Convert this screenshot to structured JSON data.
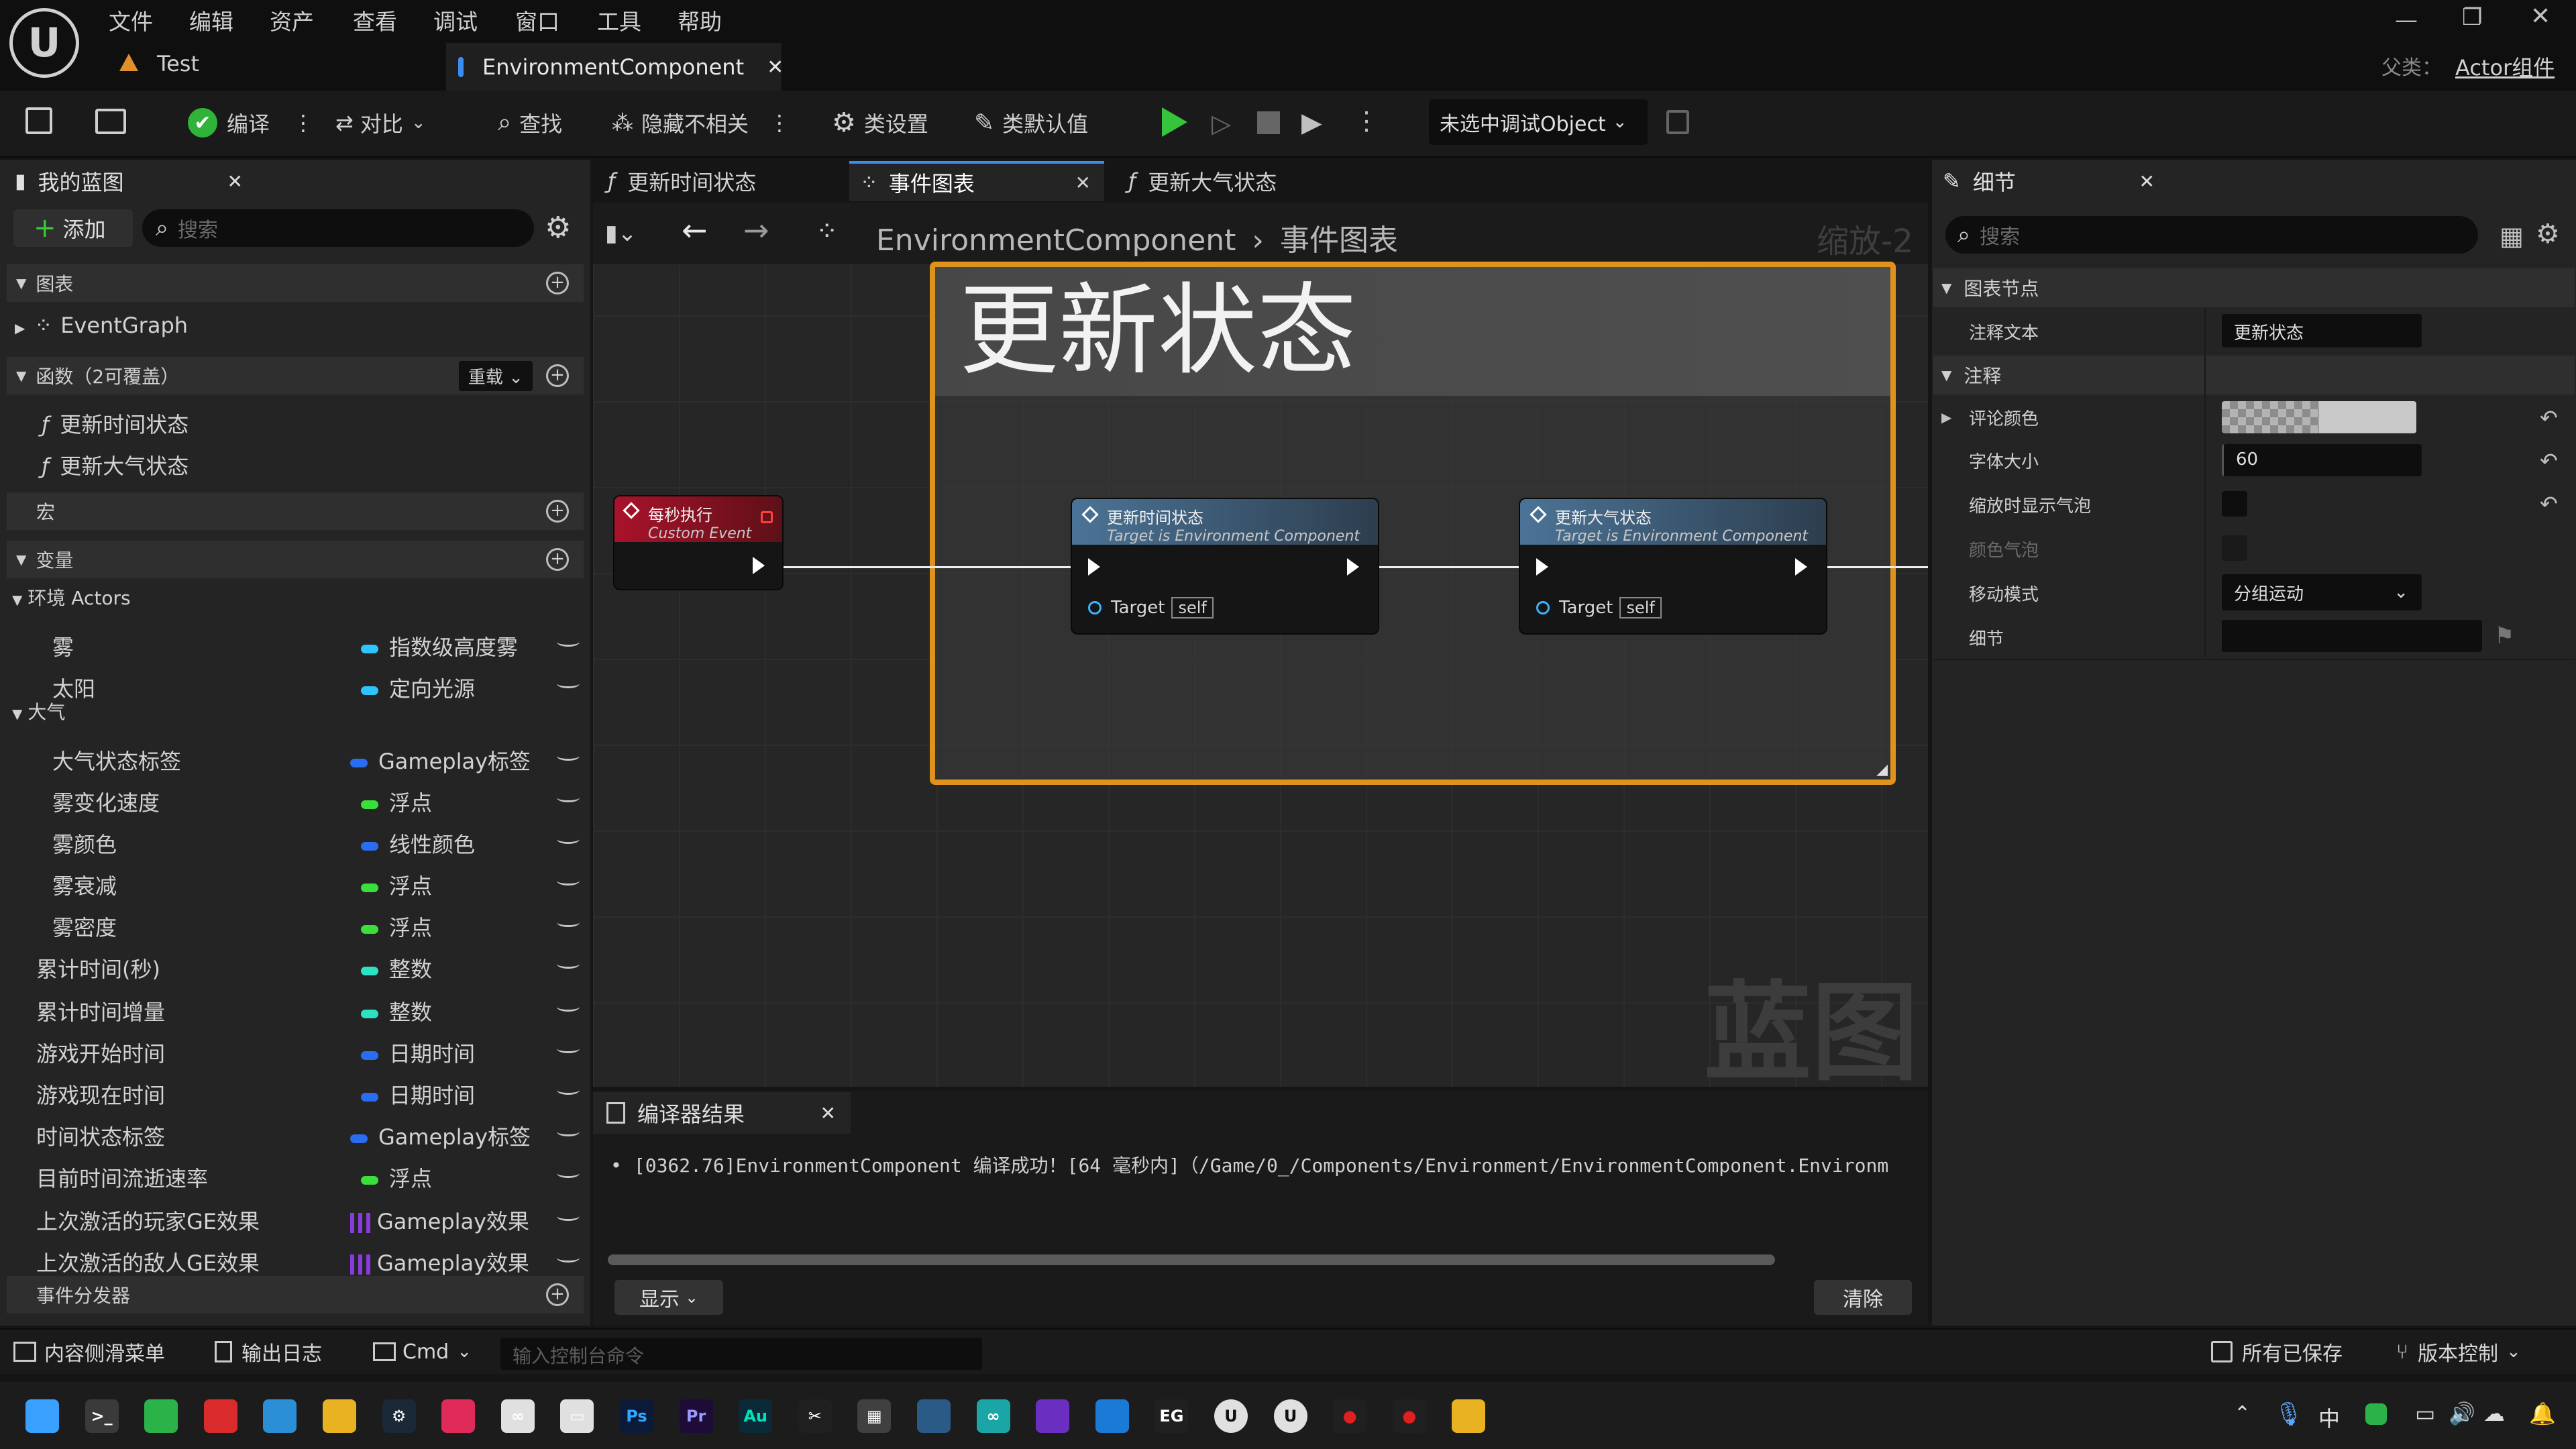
{
  "app": {
    "logo_text": "U",
    "project": "Test",
    "active_tab": "EnvironmentComponent",
    "parent_class_label": "父类：",
    "parent_class_value": "Actor组件"
  },
  "menu": [
    "文件",
    "编辑",
    "资产",
    "查看",
    "调试",
    "窗口",
    "工具",
    "帮助"
  ],
  "toolbar": {
    "compile": "编译",
    "diff": "对比",
    "find": "查找",
    "hide_unrelated": "隐藏不相关",
    "class_settings": "类设置",
    "class_defaults": "类默认值",
    "debug_object": "未选中调试Object"
  },
  "my_blueprint": {
    "title": "我的蓝图",
    "add": "添加",
    "search_placeholder": "搜索",
    "graphs_header": "图表",
    "event_graph": "EventGraph",
    "functions_header": "函数（2可覆盖）",
    "override": "重载",
    "functions": [
      "更新时间状态",
      "更新大气状态"
    ],
    "macros_header": "宏",
    "variables_header": "变量",
    "cat_actors": "环境 Actors",
    "cat_atmos": "大气",
    "variables": [
      {
        "name": "雾",
        "type": "指数级高度雾",
        "color": "#2ec4ff"
      },
      {
        "name": "太阳",
        "type": "定向光源",
        "color": "#2ec4ff"
      },
      {
        "name": "大气状态标签",
        "type": "Gameplay标签",
        "color": "#2a6df0"
      },
      {
        "name": "雾变化速度",
        "type": "浮点",
        "color": "#3adf3a"
      },
      {
        "name": "雾颜色",
        "type": "线性颜色",
        "color": "#2a6df0"
      },
      {
        "name": "雾衰减",
        "type": "浮点",
        "color": "#3adf3a"
      },
      {
        "name": "雾密度",
        "type": "浮点",
        "color": "#3adf3a"
      },
      {
        "name": "累计时间(秒)",
        "type": "整数",
        "color": "#2de2c0"
      },
      {
        "name": "累计时间增量",
        "type": "整数",
        "color": "#2de2c0"
      },
      {
        "name": "游戏开始时间",
        "type": "日期时间",
        "color": "#2a6df0"
      },
      {
        "name": "游戏现在时间",
        "type": "日期时间",
        "color": "#2a6df0"
      },
      {
        "name": "时间状态标签",
        "type": "Gameplay标签",
        "color": "#2a6df0"
      },
      {
        "name": "目前时间流逝速率",
        "type": "浮点",
        "color": "#3adf3a"
      },
      {
        "name": "上次激活的玩家GE效果",
        "type": "Gameplay效果",
        "color": "#8a3adf"
      },
      {
        "name": "上次激活的敌人GE效果",
        "type": "Gameplay效果",
        "color": "#8a3adf"
      }
    ],
    "dispatchers_header": "事件分发器"
  },
  "graph_tabs": [
    "更新时间状态",
    "事件图表",
    "更新大气状态"
  ],
  "breadcrumb": {
    "root": "EnvironmentComponent",
    "sep": "›",
    "current": "事件图表",
    "zoom": "缩放-2"
  },
  "comment_text": "更新状态",
  "nodes": {
    "event": {
      "title": "每秒执行",
      "subtitle": "Custom Event"
    },
    "fn1": {
      "title": "更新时间状态",
      "subtitle": "Target is Environment Component",
      "pin": "Target",
      "pin_value": "self"
    },
    "fn2": {
      "title": "更新大气状态",
      "subtitle": "Target is Environment Component",
      "pin": "Target",
      "pin_value": "self"
    }
  },
  "watermark": "蓝图",
  "compiler": {
    "title": "编译器结果",
    "message": "[0362.76]EnvironmentComponent 编译成功！[64 毫秒内]（/Game/0_/Components/Environment/EnvironmentComponent.Environm",
    "show": "显示",
    "clear": "清除"
  },
  "details": {
    "title": "细节",
    "search_placeholder": "搜索",
    "section_graph_node": "图表节点",
    "comment_text_label": "注释文本",
    "comment_text_value": "更新状态",
    "section_comment": "注释",
    "comment_color": "评论颜色",
    "font_size_label": "字体大小",
    "font_size_value": "60",
    "show_bubble_zoomed": "缩放时显示气泡",
    "color_bubble": "颜色气泡",
    "move_mode_label": "移动模式",
    "move_mode_value": "分组运动",
    "detail_label": "细节"
  },
  "statusbar": {
    "content_drawer": "内容侧滑菜单",
    "output_log": "输出日志",
    "cmd": "Cmd",
    "console_placeholder": "输入控制台命令",
    "all_saved": "所有已保存",
    "source_control": "版本控制"
  },
  "taskbar": {
    "ime": "中",
    "items": [
      "Ps",
      "Pr",
      "Au"
    ]
  }
}
